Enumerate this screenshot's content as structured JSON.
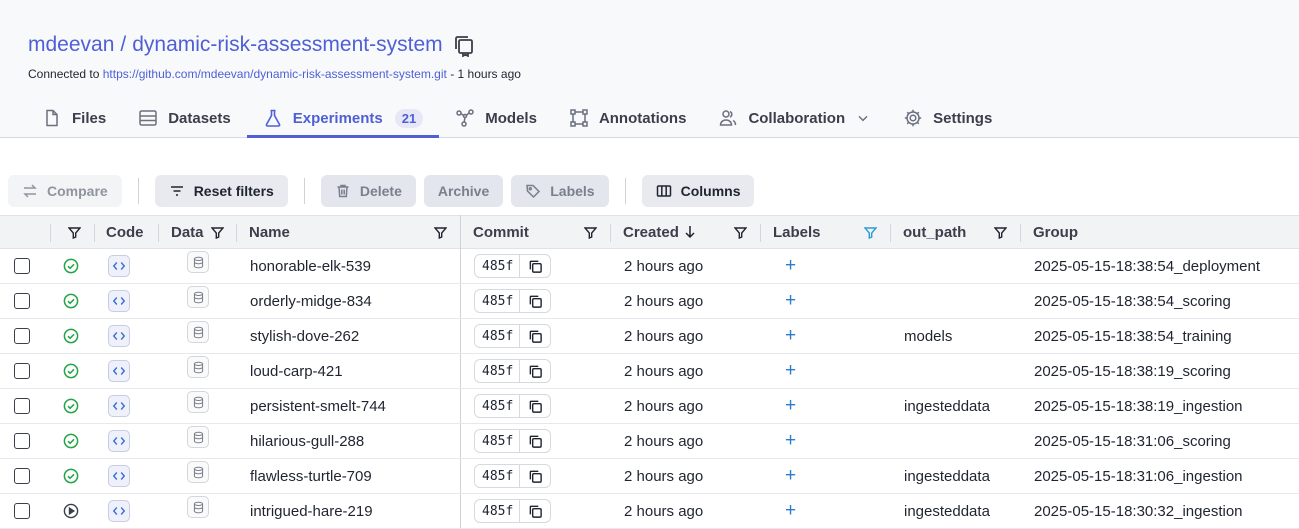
{
  "repo": {
    "owner": "mdeevan",
    "separator": "/",
    "name": "dynamic-risk-assessment-system",
    "connected_prefix": "Connected to",
    "url": "https://github.com/mdeevan/dynamic-risk-assessment-system.git",
    "connected_suffix": "- 1 hours ago"
  },
  "tabs": [
    {
      "label": "Files",
      "icon": "file-icon"
    },
    {
      "label": "Datasets",
      "icon": "dataset-icon"
    },
    {
      "label": "Experiments",
      "icon": "flask-icon",
      "badge": "21",
      "active": true
    },
    {
      "label": "Models",
      "icon": "model-icon"
    },
    {
      "label": "Annotations",
      "icon": "annotation-icon"
    },
    {
      "label": "Collaboration",
      "icon": "users-icon"
    },
    {
      "label": "Settings",
      "icon": "gear-icon"
    }
  ],
  "toolbar": {
    "compare": "Compare",
    "reset_filters": "Reset filters",
    "delete": "Delete",
    "archive": "Archive",
    "labels": "Labels",
    "columns": "Columns"
  },
  "columns": {
    "code": "Code",
    "data": "Data",
    "name": "Name",
    "commit": "Commit",
    "created": "Created",
    "labels": "Labels",
    "out_path": "out_path",
    "group": "Group"
  },
  "rows": [
    {
      "status": "success",
      "name": "honorable-elk-539",
      "commit": "485f",
      "created": "2 hours ago",
      "out_path": "",
      "group": "2025-05-15-18:38:54_deployment"
    },
    {
      "status": "success",
      "name": "orderly-midge-834",
      "commit": "485f",
      "created": "2 hours ago",
      "out_path": "",
      "group": "2025-05-15-18:38:54_scoring"
    },
    {
      "status": "success",
      "name": "stylish-dove-262",
      "commit": "485f",
      "created": "2 hours ago",
      "out_path": "models",
      "group": "2025-05-15-18:38:54_training"
    },
    {
      "status": "success",
      "name": "loud-carp-421",
      "commit": "485f",
      "created": "2 hours ago",
      "out_path": "",
      "group": "2025-05-15-18:38:19_scoring"
    },
    {
      "status": "success",
      "name": "persistent-smelt-744",
      "commit": "485f",
      "created": "2 hours ago",
      "out_path": "ingesteddata",
      "group": "2025-05-15-18:38:19_ingestion"
    },
    {
      "status": "success",
      "name": "hilarious-gull-288",
      "commit": "485f",
      "created": "2 hours ago",
      "out_path": "",
      "group": "2025-05-15-18:31:06_scoring"
    },
    {
      "status": "success",
      "name": "flawless-turtle-709",
      "commit": "485f",
      "created": "2 hours ago",
      "out_path": "ingesteddata",
      "group": "2025-05-15-18:31:06_ingestion"
    },
    {
      "status": "running",
      "name": "intrigued-hare-219",
      "commit": "485f",
      "created": "2 hours ago",
      "out_path": "ingesteddata",
      "group": "2025-05-15-18:30:32_ingestion"
    }
  ],
  "labels_add_symbol": "+",
  "colors": {
    "accent": "#4f5fd6",
    "success": "#22a447",
    "link": "#2a7bd4"
  }
}
